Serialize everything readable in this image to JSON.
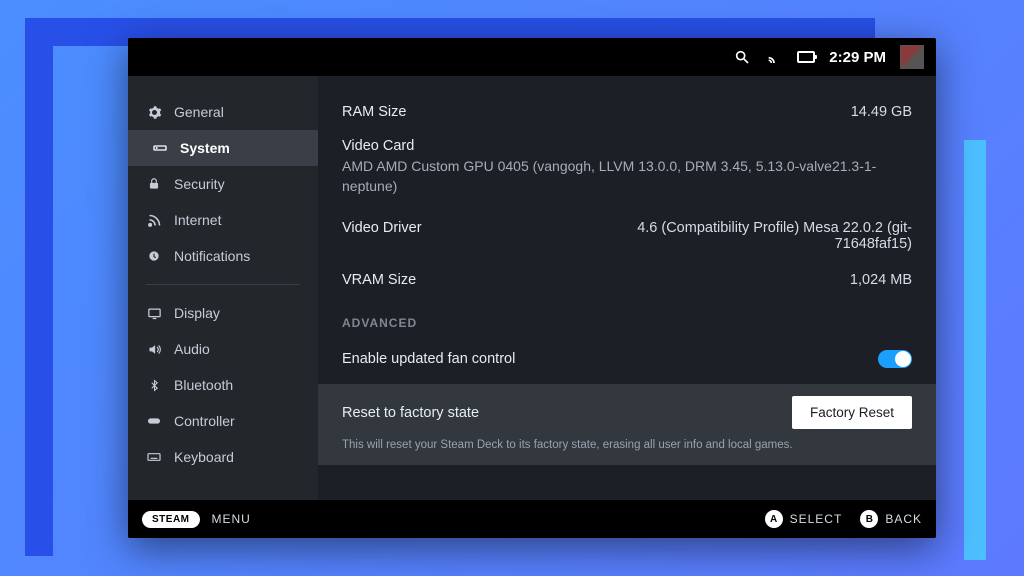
{
  "topbar": {
    "time": "2:29 PM"
  },
  "sidebar": {
    "items": [
      {
        "label": "General",
        "icon": "gear"
      },
      {
        "label": "System",
        "icon": "system"
      },
      {
        "label": "Security",
        "icon": "lock"
      },
      {
        "label": "Internet",
        "icon": "rss"
      },
      {
        "label": "Notifications",
        "icon": "bell"
      },
      {
        "label": "Display",
        "icon": "monitor"
      },
      {
        "label": "Audio",
        "icon": "speaker"
      },
      {
        "label": "Bluetooth",
        "icon": "bluetooth"
      },
      {
        "label": "Controller",
        "icon": "gamepad"
      },
      {
        "label": "Keyboard",
        "icon": "keyboard"
      }
    ]
  },
  "content": {
    "ram_label": "RAM Size",
    "ram_value": "14.49 GB",
    "video_card_label": "Video Card",
    "video_card_value": "AMD AMD Custom GPU 0405 (vangogh, LLVM 13.0.0, DRM 3.45, 5.13.0-valve21.3-1-neptune)",
    "video_driver_label": "Video Driver",
    "video_driver_value": "4.6 (Compatibility Profile) Mesa 22.0.2 (git-71648faf15)",
    "vram_label": "VRAM Size",
    "vram_value": "1,024 MB",
    "advanced_heading": "ADVANCED",
    "fan_label": "Enable updated fan control",
    "reset_label": "Reset to factory state",
    "reset_btn": "Factory Reset",
    "reset_desc": "This will reset your Steam Deck to its factory state, erasing all user info and local games."
  },
  "footer": {
    "steam": "STEAM",
    "menu": "MENU",
    "select": "SELECT",
    "back": "BACK",
    "a": "A",
    "b": "B"
  }
}
